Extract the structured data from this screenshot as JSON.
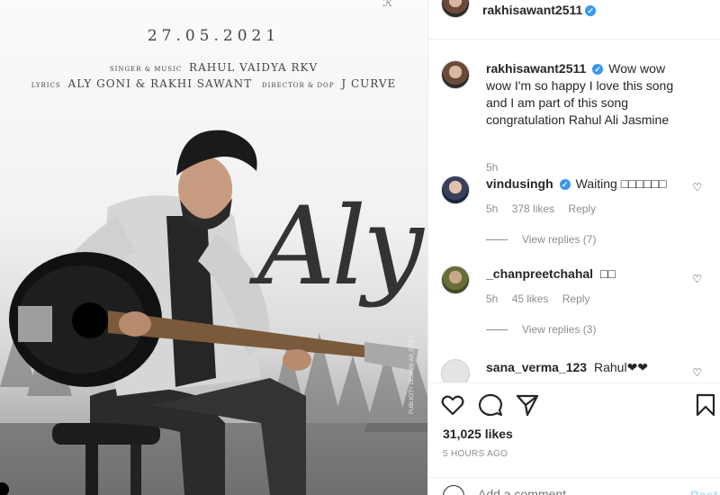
{
  "poster": {
    "date": "27.05.2021",
    "credit_line1_small": "SINGER & MUSIC",
    "credit_line1": "RAHUL VAIDYA RKV",
    "credit_line2_small1": "LYRICS",
    "credit_line2_a": "ALY GONI & RAKHI SAWANT",
    "credit_line2_small2": "DIRECTOR & DOP",
    "credit_line2_b": "J CURVE",
    "script_title": "Aly",
    "side_credit": "PUBLICITY DESIGN: AA_EDITS"
  },
  "header": {
    "username": "rakhisawant2511"
  },
  "comments": [
    {
      "username": "rakhisawant2511",
      "verified": true,
      "text": "Wow wow wow I'm so happy I love this song and I am part of this song congratulation Rahul Ali Jasmine",
      "time": "5h"
    },
    {
      "username": "vindusingh",
      "verified": true,
      "text": "Waiting □□□□□□",
      "time": "5h",
      "likes": "378 likes",
      "reply": "Reply",
      "view_replies": "View replies (7)"
    },
    {
      "username": "_chanpreetchahal",
      "verified": false,
      "text": "□□",
      "time": "5h",
      "likes": "45 likes",
      "reply": "Reply",
      "view_replies": "View replies (3)"
    },
    {
      "username": "sana_verma_123",
      "verified": false,
      "text": "Rahul❤❤"
    }
  ],
  "actions": {
    "likes": "31,025 likes",
    "time_ago": "5 HOURS AGO",
    "comment_placeholder": "Add a comment...",
    "post_label": "Post"
  },
  "icons": {
    "like": "heart-icon",
    "comment": "comment-icon",
    "share": "share-icon",
    "save": "bookmark-icon",
    "emoji": "emoji-icon",
    "verified": "verified-badge-icon"
  },
  "colors": {
    "verified": "#3897f0",
    "muted_text": "#8e8e8e",
    "post_button_disabled": "#b2dffc"
  }
}
